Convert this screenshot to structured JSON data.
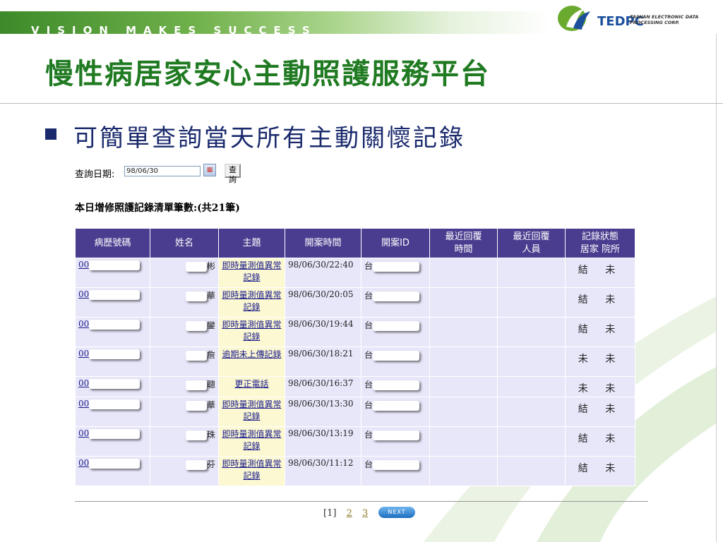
{
  "banner": {
    "motto": "VISION MAKES SUCCESS",
    "logo_text": "TEDPC",
    "logo_subtitle": "TAIWAN ELECTRONIC DATA PROCESSING CORP."
  },
  "page_title": "慢性病居家安心主動照護服務平台",
  "bullet": "可簡單查詢當天所有主動關懷記錄",
  "query": {
    "label": "查詢日期:",
    "date_value": "98/06/30",
    "button_label": "查詢"
  },
  "summary": "本日增修照護記錄清單筆數:(共21筆)",
  "table": {
    "headers": [
      "病歷號碼",
      "姓名",
      "主題",
      "開案時間",
      "開案ID",
      "最近回覆\n時間",
      "最近回覆\n人員",
      "記錄狀態\n居家 院所"
    ],
    "rows": [
      {
        "record_no": "00",
        "name": "彬",
        "topic": "即時量測值異常記錄",
        "time": "98/06/30/22:40",
        "case_id": "台",
        "reply_time": "",
        "reply_person": "",
        "status": "結 未"
      },
      {
        "record_no": "00",
        "name": "華",
        "topic": "即時量測值異常記錄",
        "time": "98/06/30/20:05",
        "case_id": "台",
        "reply_time": "",
        "reply_person": "",
        "status": "結 未"
      },
      {
        "record_no": "00",
        "name": "鑾",
        "topic": "即時量測值異常記錄",
        "time": "98/06/30/19:44",
        "case_id": "台",
        "reply_time": "",
        "reply_person": "",
        "status": "結 未"
      },
      {
        "record_no": "00",
        "name": "詹",
        "topic": "逾期未上傳記錄",
        "time": "98/06/30/18:21",
        "case_id": "台",
        "reply_time": "",
        "reply_person": "",
        "status": "未 未"
      },
      {
        "record_no": "00",
        "name": "聰",
        "topic": "更正電話",
        "time": "98/06/30/16:37",
        "case_id": "台",
        "reply_time": "",
        "reply_person": "",
        "status": "未 未"
      },
      {
        "record_no": "00",
        "name": "華",
        "topic": "即時量測值異常記錄",
        "time": "98/06/30/13:30",
        "case_id": "台",
        "reply_time": "",
        "reply_person": "",
        "status": "結 未"
      },
      {
        "record_no": "00",
        "name": "珠",
        "topic": "即時量測值異常記錄",
        "time": "98/06/30/13:19",
        "case_id": "台",
        "reply_time": "",
        "reply_person": "",
        "status": "結 未"
      },
      {
        "record_no": "00",
        "name": "芬",
        "topic": "即時量測值異常記錄",
        "time": "98/06/30/11:12",
        "case_id": "台",
        "reply_time": "",
        "reply_person": "",
        "status": "結 未"
      }
    ]
  },
  "pager": {
    "current": "[1]",
    "pages": [
      "2",
      "3"
    ],
    "next_label": "NEXT"
  },
  "colors": {
    "title_green": "#1f7a21",
    "header_purple": "#4a3d8f",
    "row_lavender": "#e8e7fa",
    "topic_cream": "#fbf8d2"
  }
}
